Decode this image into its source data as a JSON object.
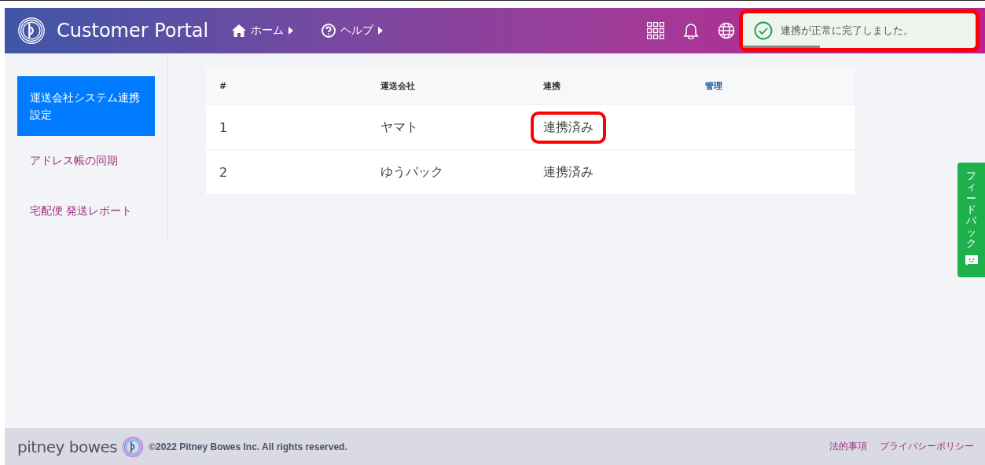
{
  "header": {
    "title": "Customer Portal",
    "nav": [
      {
        "kind": "home",
        "label": "ホーム"
      },
      {
        "kind": "help",
        "label": "ヘルプ"
      }
    ]
  },
  "toast": {
    "message": "連携が正常に完了しました。",
    "level": 0.33,
    "highlighted": true
  },
  "sidebar": {
    "items": [
      {
        "label": "運送会社システム連携設定",
        "selected": true
      },
      {
        "label": "アドレス帳の同期",
        "selected": false
      },
      {
        "label": "宅配便 発送レポート",
        "selected": false
      }
    ]
  },
  "table": {
    "columns": [
      {
        "label": "#",
        "kind": "plain"
      },
      {
        "label": "運送会社",
        "kind": "plain"
      },
      {
        "label": "連携",
        "kind": "plain"
      },
      {
        "label": "管理",
        "kind": "link"
      }
    ],
    "rows": [
      {
        "number": "1",
        "carrier": "ヤマト",
        "status": "連携済み",
        "highlighted": true
      },
      {
        "number": "2",
        "carrier": "ゆうパック",
        "status": "連携済み",
        "highlighted": false
      }
    ]
  },
  "feedback": {
    "label": "フィードバック"
  },
  "footer": {
    "brand": "pitney bowes",
    "copyright": "©2022 Pitney Bowes Inc. All rights reserved.",
    "links": [
      "法的事項",
      "プライバシーポリシー"
    ]
  }
}
